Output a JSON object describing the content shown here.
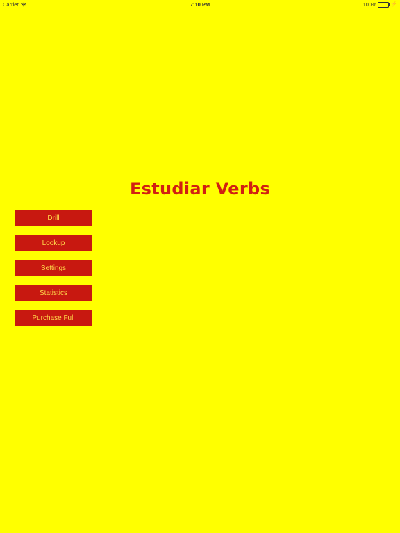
{
  "status_bar": {
    "carrier": "Carrier",
    "time": "7:10 PM",
    "battery": "100%",
    "battery_color": "#3ccb3c",
    "icons": [
      "wifi-icon",
      "battery-icon",
      "charging-icon"
    ]
  },
  "title": "Estudiar Verbs",
  "menu": [
    {
      "label": "Drill"
    },
    {
      "label": "Lookup"
    },
    {
      "label": "Settings"
    },
    {
      "label": "Statistics"
    },
    {
      "label": "Purchase Full"
    }
  ],
  "colors": {
    "background": "#ffff00",
    "title": "#d12012",
    "button_bg": "#c81810",
    "button_text": "#ffd84a"
  }
}
